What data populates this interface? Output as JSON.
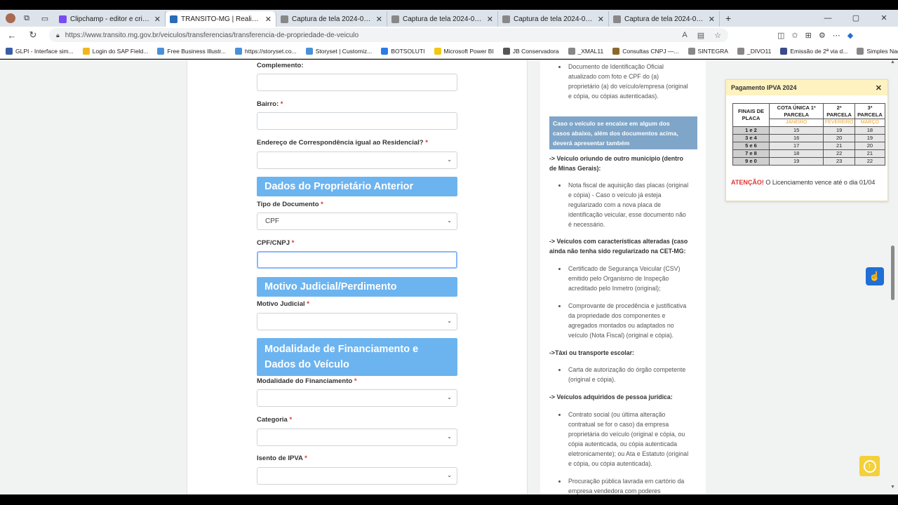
{
  "tabs": [
    {
      "title": "Clipchamp - editor e criador",
      "fav": "#7a4cf0"
    },
    {
      "title": "TRÂNSITO-MG | Realizar Transfe",
      "fav": "#2a6db5",
      "active": true
    },
    {
      "title": "Captura de tela 2024-02-09 085",
      "fav": "#888"
    },
    {
      "title": "Captura de tela 2024-02-09 085",
      "fav": "#888"
    },
    {
      "title": "Captura de tela 2024-02-09 085",
      "fav": "#888"
    },
    {
      "title": "Captura de tela 2024-02-09 085",
      "fav": "#888"
    }
  ],
  "address": {
    "url": "https://www.transito.mg.gov.br/veiculos/transferencias/transferencia-de-propriedade-de-veiculo"
  },
  "bookmarks": [
    {
      "label": "GLPI - Interface sim...",
      "color": "#3a5da8"
    },
    {
      "label": "Login do SAP Field...",
      "color": "#f2b51c"
    },
    {
      "label": "Free Business Illustr...",
      "color": "#4a90d9"
    },
    {
      "label": "https://storyset.co...",
      "color": "#4a90d9"
    },
    {
      "label": "Storyset | Customiz...",
      "color": "#4a90d9"
    },
    {
      "label": "BOTSOLUTI",
      "color": "#2c7be5"
    },
    {
      "label": "Microsoft Power BI",
      "color": "#f2c811"
    },
    {
      "label": "JB Conservadora",
      "color": "#555"
    },
    {
      "label": "_XMAL11",
      "color": "#888"
    },
    {
      "label": "Consultas CNPJ —...",
      "color": "#8a6a2a"
    },
    {
      "label": "SINTEGRA",
      "color": "#888"
    },
    {
      "label": "_DIVO11",
      "color": "#888"
    },
    {
      "label": "Emissão de 2ª via d...",
      "color": "#3a4a8a"
    },
    {
      "label": "Simples Nacional",
      "color": "#888"
    }
  ],
  "form": {
    "complemento_label": "Complemento:",
    "bairro_label": "Bairro:",
    "endereco_label": "Endereço de Correspondência igual ao Residencial?",
    "section_proprietario": "Dados do Proprietário Anterior",
    "tipo_doc_label": "Tipo de Documento",
    "tipo_doc_value": "CPF",
    "cpf_label": "CPF/CNPJ",
    "section_motivo": "Motivo Judicial/Perdimento",
    "motivo_label": "Motivo Judicial",
    "section_modalidade_1": "Modalidade de Financiamento e",
    "section_modalidade_2": "Dados do Veículo",
    "modalidade_label": "Modalidade do Financiamento",
    "categoria_label": "Categoria",
    "isento_label": "Isento de IPVA",
    "required_mark": "*"
  },
  "info": {
    "doc_id_1": "Documento de Identificação Oficial",
    "doc_id_2": "atualizado com foto e CPF do (a)",
    "doc_id_3": "proprietário (a) do veículo/empresa (original",
    "doc_id_4": "e cópia, ou cópias autenticadas).",
    "callout_1": "Caso o veículo se encaixe em algum dos",
    "callout_2": "casos abaixo, além dos documentos acima,",
    "callout_3": "deverá apresentar também",
    "h_outro_1": "-> Veículo oriundo de outro município (dentro",
    "h_outro_2": "de Minas Gerais):",
    "nf_1": "Nota fiscal de aquisição das placas (original",
    "nf_2": "e cópia) - Caso o veículo já esteja",
    "nf_3": "regularizado com a nova placa de",
    "nf_4": "identificação veicular, esse documento não",
    "nf_5": "é necessário.",
    "h_carac_1": "-> Veículos com características alteradas (caso",
    "h_carac_2": "ainda não tenha sido regularizado na CET-MG:",
    "csv_1": "Certificado de Segurança Veicular (CSV)",
    "csv_2": "emitido pelo Organismo de Inspeção",
    "csv_3": "acreditado pelo Inmetro (original);",
    "comp_1": "Comprovante de procedência e justificativa",
    "comp_2": "da propriedade dos componentes e",
    "comp_3": "agregados montados ou adaptados no",
    "comp_4": "veículo (Nota Fiscal) (original e cópia).",
    "h_taxi": "->Táxi ou transporte escolar:",
    "taxi_1": "Carta de autorização do órgão competente",
    "taxi_2": "(original e cópia).",
    "h_pj": "-> Veículos adquiridos de pessoa jurídica:",
    "pj_1": "Contrato social (ou última alteração",
    "pj_2": "contratual se for o caso) da empresa",
    "pj_3": "proprietária do veículo (original e cópia, ou",
    "pj_4": "cópia autenticada, ou cópia autenticada",
    "pj_5": "eletronicamente); ou Ata e Estatuto (original",
    "pj_6": "e cópia, ou cópia autenticada).",
    "proc_1": "Procuração pública lavrada em cartório da",
    "proc_2": "empresa vendedora com poderes"
  },
  "ipva": {
    "title": "Pagamento IPVA 2024",
    "headers": [
      "FINAIS DE PLACA",
      "COTA ÚNICA 1ª PARCELA",
      "2ª PARCELA",
      "3ª PARCELA"
    ],
    "months": [
      "JANEIRO",
      "FEVEREIRO",
      "MARÇO"
    ],
    "rows": [
      {
        "final": "1 e 2",
        "c1": "15",
        "c2": "19",
        "c3": "18"
      },
      {
        "final": "3 e 4",
        "c1": "16",
        "c2": "20",
        "c3": "19"
      },
      {
        "final": "5 e 6",
        "c1": "17",
        "c2": "21",
        "c3": "20"
      },
      {
        "final": "7 e 8",
        "c1": "18",
        "c2": "22",
        "c3": "21"
      },
      {
        "final": "9 e 0",
        "c1": "19",
        "c2": "23",
        "c3": "22"
      }
    ],
    "att_label": "ATENÇÃO!",
    "att_text": " O Licenciamento vence até o dia 01/04"
  }
}
